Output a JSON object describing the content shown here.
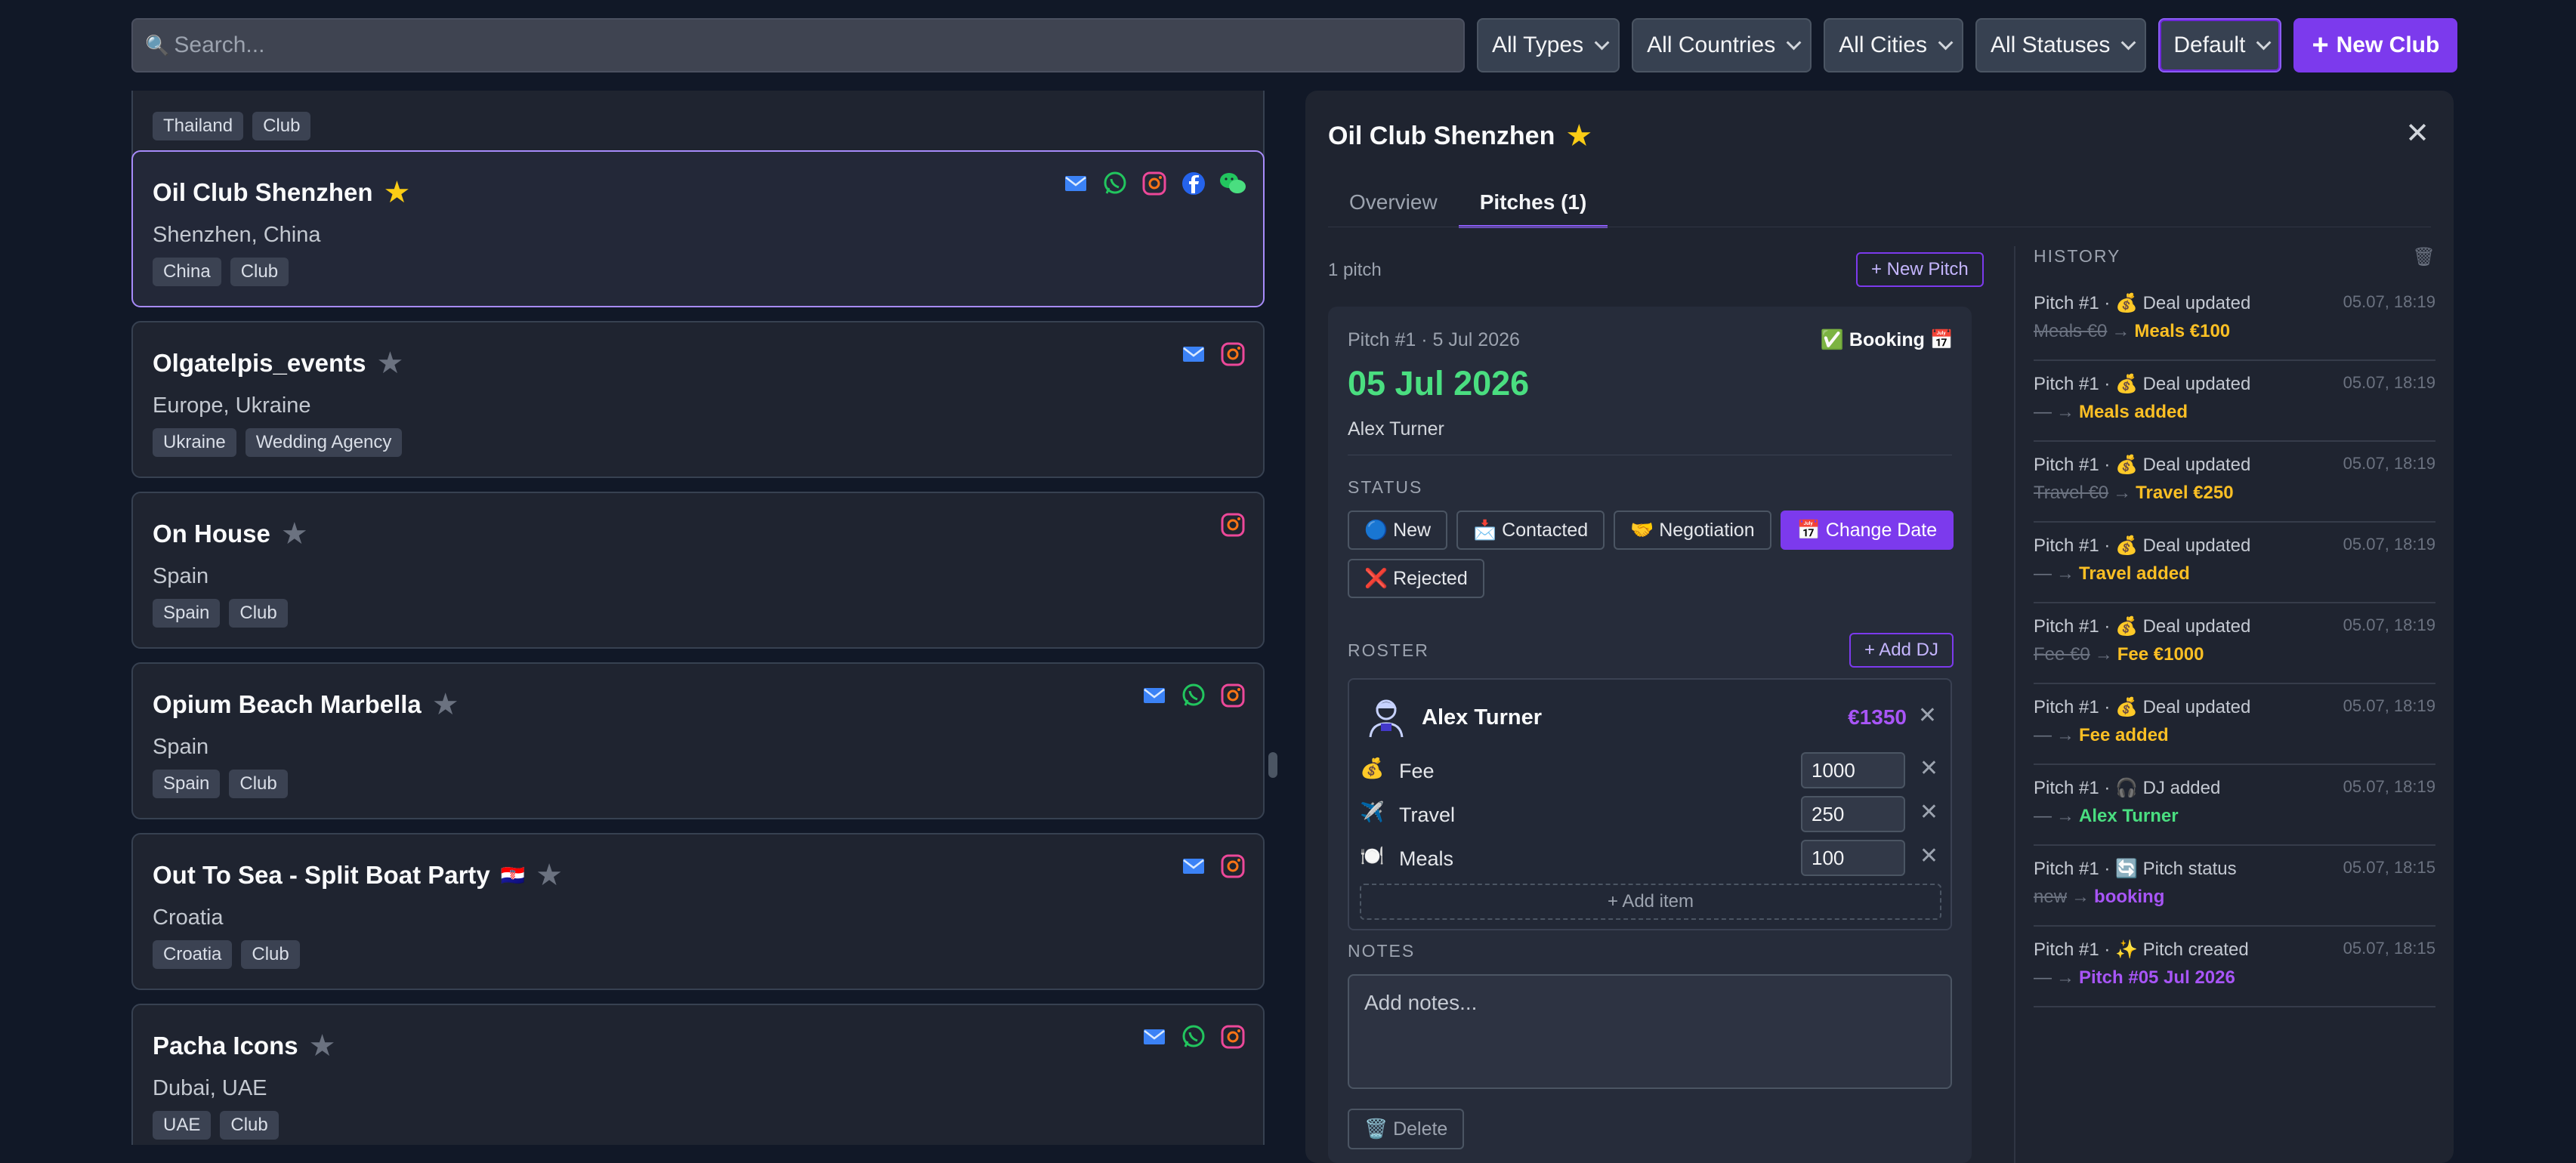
{
  "search": {
    "placeholder": "Search..."
  },
  "filters": [
    "All Types",
    "All Countries",
    "All Cities",
    "All Statuses",
    "Default"
  ],
  "new_club_label": "New Club",
  "clubs": [
    {
      "name": "",
      "sub": "",
      "tags": [
        "Thailand",
        "Club"
      ],
      "starred": false,
      "flag": "",
      "icons": []
    },
    {
      "name": "Oil Club Shenzhen",
      "sub": "Shenzhen, China",
      "tags": [
        "China",
        "Club"
      ],
      "starred": true,
      "flag": "",
      "icons": [
        "email-icon",
        "whatsapp-icon",
        "instagram-icon",
        "facebook-icon",
        "wechat-icon"
      ]
    },
    {
      "name": "Olgatelpis_events",
      "sub": "Europe, Ukraine",
      "tags": [
        "Ukraine",
        "Wedding Agency"
      ],
      "starred": false,
      "flag": "",
      "icons": [
        "email-icon",
        "instagram-icon"
      ]
    },
    {
      "name": "On House",
      "sub": "Spain",
      "tags": [
        "Spain",
        "Club"
      ],
      "starred": false,
      "flag": "",
      "icons": [
        "instagram-icon"
      ]
    },
    {
      "name": "Opium Beach Marbella",
      "sub": "Spain",
      "tags": [
        "Spain",
        "Club"
      ],
      "starred": false,
      "flag": "",
      "icons": [
        "email-icon",
        "whatsapp-icon",
        "instagram-icon"
      ]
    },
    {
      "name": "Out To Sea - Split Boat Party",
      "sub": "Croatia",
      "tags": [
        "Croatia",
        "Club"
      ],
      "starred": false,
      "flag": "🇭🇷",
      "icons": [
        "email-icon",
        "instagram-icon"
      ]
    },
    {
      "name": "Pacha Icons",
      "sub": "Dubai, UAE",
      "tags": [
        "UAE",
        "Club"
      ],
      "starred": false,
      "flag": "",
      "icons": [
        "email-icon",
        "whatsapp-icon",
        "instagram-icon"
      ]
    }
  ],
  "detail": {
    "title": "Oil Club Shenzhen",
    "close": "✕",
    "tabs": [
      "Overview",
      "Pitches (1)"
    ],
    "pitch_count": "1 pitch",
    "new_pitch": "+ New Pitch",
    "pitch": {
      "meta": "Pitch #1 · 5 Jul 2026",
      "status_badge": "✅ Booking 📅",
      "date": "05 Jul 2026",
      "dj": "Alex Turner",
      "status_label": "STATUS",
      "statuses": [
        {
          "label": "🔵 New",
          "active": false
        },
        {
          "label": "📩 Contacted",
          "active": false
        },
        {
          "label": "🤝 Negotiation",
          "active": false
        },
        {
          "label": "📅 Change Date",
          "active": true
        },
        {
          "label": "❌ Rejected",
          "active": false
        }
      ],
      "roster_label": "ROSTER",
      "add_dj": "+ Add DJ",
      "roster": {
        "name": "Alex Turner",
        "total": "€1350",
        "items": [
          {
            "icon": "💰",
            "label": "Fee",
            "currency": "€",
            "value": "1000"
          },
          {
            "icon": "✈️",
            "label": "Travel",
            "currency": "€",
            "value": "250"
          },
          {
            "icon": "🍽️",
            "label": "Meals",
            "currency": "€",
            "value": "100"
          }
        ],
        "add_item": "+ Add item"
      },
      "notes_label": "NOTES",
      "notes_placeholder": "Add notes...",
      "delete": "🗑️ Delete"
    },
    "history": {
      "title": "HISTORY",
      "entries": [
        {
          "line1": "Pitch #1 · 💰 Deal updated",
          "time": "05.07, 18:19",
          "old": "Meals €0",
          "new": "Meals €100",
          "color": "yellow"
        },
        {
          "line1": "Pitch #1 · 💰 Deal updated",
          "time": "05.07, 18:19",
          "old": "—",
          "new": "Meals added",
          "color": "yellow"
        },
        {
          "line1": "Pitch #1 · 💰 Deal updated",
          "time": "05.07, 18:19",
          "old": "Travel €0",
          "new": "Travel €250",
          "color": "yellow"
        },
        {
          "line1": "Pitch #1 · 💰 Deal updated",
          "time": "05.07, 18:19",
          "old": "—",
          "new": "Travel added",
          "color": "yellow"
        },
        {
          "line1": "Pitch #1 · 💰 Deal updated",
          "time": "05.07, 18:19",
          "old": "Fee €0",
          "new": "Fee €1000",
          "color": "yellow"
        },
        {
          "line1": "Pitch #1 · 💰 Deal updated",
          "time": "05.07, 18:19",
          "old": "—",
          "new": "Fee added",
          "color": "yellow"
        },
        {
          "line1": "Pitch #1 · 🎧 DJ added",
          "time": "05.07, 18:19",
          "old": "—",
          "new": "Alex Turner",
          "color": "green"
        },
        {
          "line1": "Pitch #1 · 🔄 Pitch status",
          "time": "05.07, 18:15",
          "old": "new",
          "new": "booking",
          "color": "purple"
        },
        {
          "line1": "Pitch #1 · ✨ Pitch created",
          "time": "05.07, 18:15",
          "old": "—",
          "new": "Pitch #05 Jul 2026",
          "color": "purple"
        }
      ]
    }
  },
  "colors": {
    "accent": "#7c3aed",
    "bg": "#111827",
    "card": "#1f2430",
    "star": "#facc15",
    "success": "#4ade80"
  }
}
